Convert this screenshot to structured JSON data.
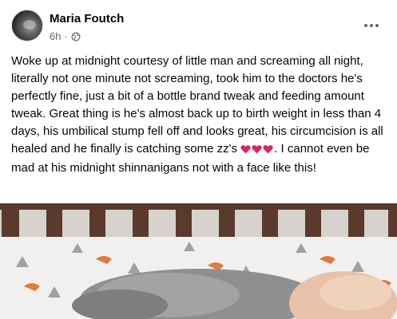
{
  "post": {
    "author": "Maria Foutch",
    "time": "6h",
    "separator": "·",
    "text_before_emoji": "Woke up at midnight courtesy of little man and screaming all night, literally not one minute not screaming, took him to the doctors he's perfectly fine, just a bit of a bottle brand tweak and feeding amount tweak. Great thing is he's almost back up to birth weight in less than 4 days, his umbilical stump fell off and looks great, his circumcision is all healed and he finally is catching some zz's",
    "text_after_emoji": ". I cannot even be mad at his midnight shinnanigans not with a face like this!",
    "emoji": "heart-emoji x3"
  },
  "icons": {
    "privacy": "globe-icon",
    "menu": "more-options-icon"
  },
  "colors": {
    "heart": "#e0245e",
    "secondary_text": "#65676b",
    "crib_rail": "#5a3a2c",
    "sheet": "#f2f0ee"
  }
}
